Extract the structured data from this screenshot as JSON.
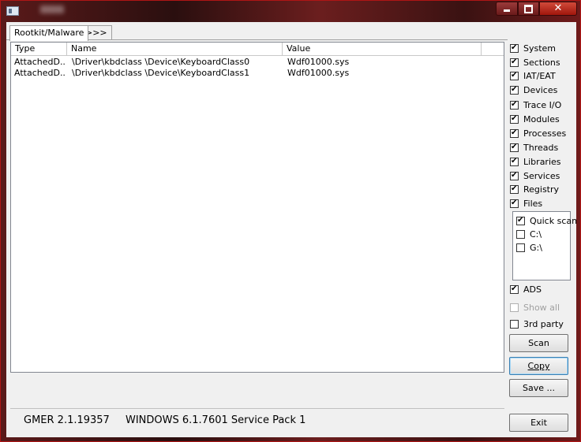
{
  "window": {
    "controls": {
      "minimize_icon": "minimize-icon",
      "maximize_icon": "maximize-icon",
      "close_icon": "close-icon"
    }
  },
  "tabs": [
    {
      "label": "Rootkit/Malware",
      "active": true
    },
    {
      "label": ">>>",
      "active": false
    }
  ],
  "table": {
    "columns": [
      "Type",
      "Name",
      "Value"
    ],
    "rows": [
      {
        "type": "AttachedD...",
        "name": "\\Driver\\kbdclass \\Device\\KeyboardClass0",
        "value": "Wdf01000.sys"
      },
      {
        "type": "AttachedD...",
        "name": "\\Driver\\kbdclass \\Device\\KeyboardClass1",
        "value": "Wdf01000.sys"
      }
    ]
  },
  "options": [
    {
      "label": "System",
      "checked": true
    },
    {
      "label": "Sections",
      "checked": true
    },
    {
      "label": "IAT/EAT",
      "checked": true
    },
    {
      "label": "Devices",
      "checked": true
    },
    {
      "label": "Trace I/O",
      "checked": true
    },
    {
      "label": "Modules",
      "checked": true
    },
    {
      "label": "Processes",
      "checked": true
    },
    {
      "label": "Threads",
      "checked": true
    },
    {
      "label": "Libraries",
      "checked": true
    },
    {
      "label": "Services",
      "checked": true
    },
    {
      "label": "Registry",
      "checked": true
    },
    {
      "label": "Files",
      "checked": true
    }
  ],
  "drives": [
    {
      "label": "Quick scan",
      "checked": true
    },
    {
      "label": "C:\\",
      "checked": false
    },
    {
      "label": "G:\\",
      "checked": false
    }
  ],
  "extra_options": {
    "ads": {
      "label": "ADS",
      "checked": true
    },
    "show_all": {
      "label": "Show all",
      "checked": false,
      "disabled": true
    },
    "third_party": {
      "label": "3rd party",
      "checked": false
    }
  },
  "buttons": {
    "scan": "Scan",
    "copy": "Copy",
    "save": "Save ...",
    "exit": "Exit"
  },
  "status": {
    "version": "GMER 2.1.19357",
    "os": "WINDOWS 6.1.7601 Service Pack 1"
  }
}
